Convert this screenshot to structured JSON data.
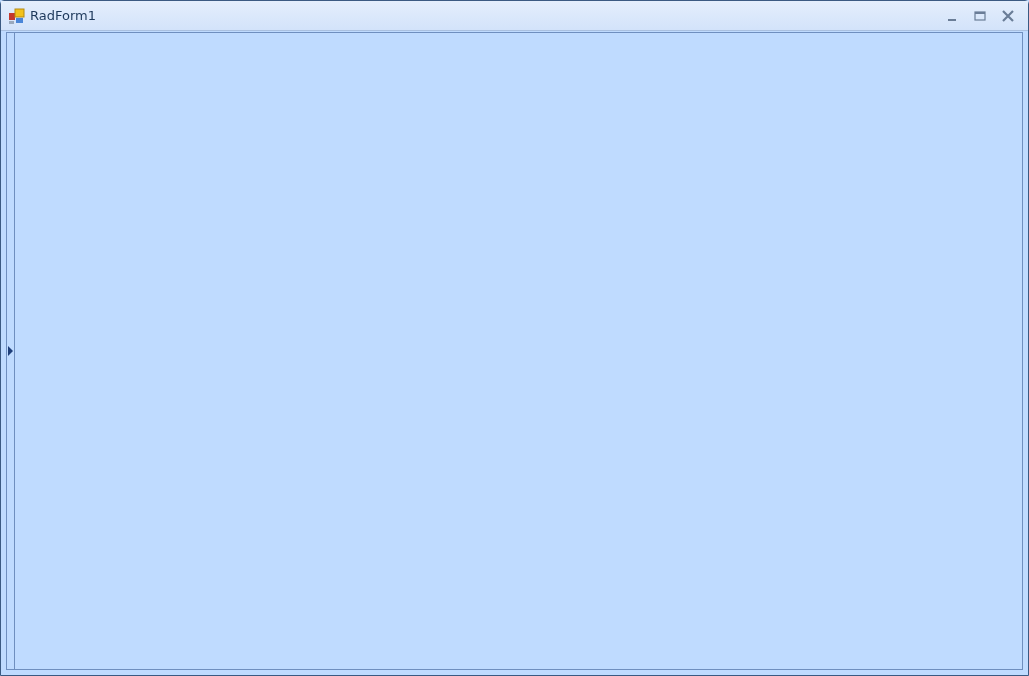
{
  "window": {
    "title": "RadForm1"
  },
  "side_panel": {
    "expanded": false
  }
}
